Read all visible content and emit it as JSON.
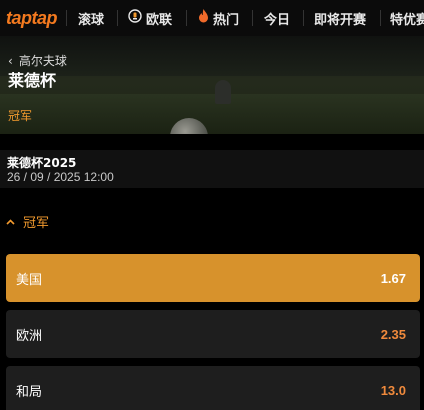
{
  "nav": {
    "logo": "taptap",
    "items": [
      {
        "label": "滚球",
        "icon": ""
      },
      {
        "label": "欧联",
        "icon": "trophy-icon"
      },
      {
        "label": "热门",
        "icon": "fire-icon"
      },
      {
        "label": "今日",
        "icon": ""
      },
      {
        "label": "即将开赛",
        "icon": ""
      },
      {
        "label": "特优赛",
        "icon": ""
      }
    ]
  },
  "hero": {
    "back_label": "高尔夫球",
    "title": "莱德杯",
    "subtitle": "冠军"
  },
  "event": {
    "name": "莱德杯2025",
    "date": "26 / 09 / 2025 12:00"
  },
  "market": {
    "title": "冠军",
    "selections": [
      {
        "name": "美国",
        "odds": "1.67",
        "selected": true
      },
      {
        "name": "欧洲",
        "odds": "2.35",
        "selected": false
      },
      {
        "name": "和局",
        "odds": "13.0",
        "selected": false
      }
    ]
  },
  "colors": {
    "accent": "#f29a2e",
    "selected_bg": "#d7922c",
    "odds": "#f08a3c"
  }
}
